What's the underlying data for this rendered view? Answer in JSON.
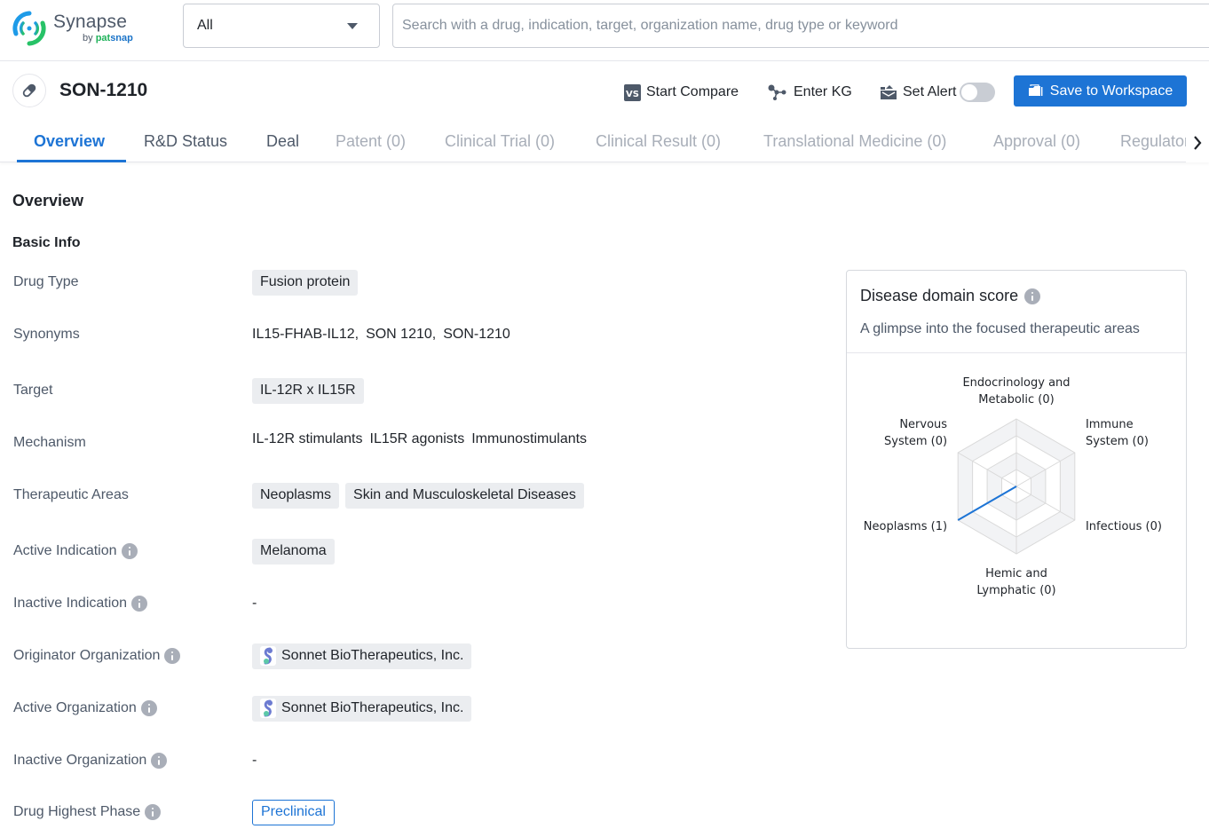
{
  "brand": {
    "name": "Synapse",
    "by": "by",
    "by_brand_1": "pat",
    "by_brand_2": "snap"
  },
  "search": {
    "scope_selected": "All",
    "placeholder": "Search with a drug, indication, target, organization name, drug type or keyword",
    "value": ""
  },
  "drug": {
    "name": "SON-1210",
    "icon": "pill-icon"
  },
  "actions": {
    "compare": "Start Compare",
    "kg": "Enter KG",
    "alert": "Set Alert",
    "alert_on": false,
    "save": "Save to Workspace"
  },
  "tabs": [
    {
      "label": "Overview",
      "state": "active"
    },
    {
      "label": "R&D Status",
      "state": "enabled"
    },
    {
      "label": "Deal",
      "state": "enabled"
    },
    {
      "label": "Patent (0)",
      "state": "disabled"
    },
    {
      "label": "Clinical Trial (0)",
      "state": "disabled"
    },
    {
      "label": "Clinical Result (0)",
      "state": "disabled"
    },
    {
      "label": "Translational Medicine (0)",
      "state": "disabled"
    },
    {
      "label": "Approval (0)",
      "state": "disabled"
    },
    {
      "label": "Regulatory",
      "state": "disabled"
    }
  ],
  "overview": {
    "title": "Overview",
    "basic_info_title": "Basic Info",
    "fields": {
      "drug_type": {
        "label": "Drug Type",
        "tags": [
          "Fusion protein"
        ]
      },
      "synonyms": {
        "label": "Synonyms",
        "values": [
          "IL15-FHAB-IL12,",
          "SON 1210,",
          "SON-1210"
        ]
      },
      "target": {
        "label": "Target",
        "tags": [
          "IL-12R x IL15R"
        ]
      },
      "mechanism": {
        "label": "Mechanism",
        "values": [
          "IL-12R stimulants",
          "IL15R agonists",
          "Immunostimulants"
        ]
      },
      "therapeutic_areas": {
        "label": "Therapeutic Areas",
        "tags": [
          "Neoplasms",
          "Skin and Musculoskeletal Diseases"
        ]
      },
      "active_indication": {
        "label": "Active Indication",
        "tags": [
          "Melanoma"
        ]
      },
      "inactive_indication": {
        "label": "Inactive Indication",
        "value": "-"
      },
      "originator_org": {
        "label": "Originator Organization",
        "org": "Sonnet BioTherapeutics, Inc."
      },
      "active_org": {
        "label": "Active Organization",
        "org": "Sonnet BioTherapeutics, Inc."
      },
      "inactive_org": {
        "label": "Inactive Organization",
        "value": "-"
      },
      "highest_phase": {
        "label": "Drug Highest Phase",
        "phase": "Preclinical"
      }
    }
  },
  "disease_card": {
    "title": "Disease domain score",
    "subtitle": "A glimpse into the focused therapeutic areas"
  },
  "chart_data": {
    "type": "radar",
    "title": "Disease domain score",
    "axes": [
      {
        "label_lines": [
          "Endocrinology and",
          "Metabolic (0)"
        ],
        "name": "Endocrinology and Metabolic",
        "value": 0
      },
      {
        "label_lines": [
          "Immune",
          "System (0)"
        ],
        "name": "Immune System",
        "value": 0
      },
      {
        "label_lines": [
          "Infectious (0)"
        ],
        "name": "Infectious",
        "value": 0
      },
      {
        "label_lines": [
          "Hemic and",
          "Lymphatic (0)"
        ],
        "name": "Hemic and Lymphatic",
        "value": 0
      },
      {
        "label_lines": [
          "Neoplasms (1)"
        ],
        "name": "Neoplasms",
        "value": 1
      },
      {
        "label_lines": [
          "Nervous",
          "System (0)"
        ],
        "name": "Nervous System",
        "value": 0
      }
    ],
    "max": 1,
    "rings": 4,
    "series_color": "#1d74d5"
  },
  "colors": {
    "accent": "#1d74d5",
    "tag_bg": "#ebedf0",
    "muted_text": "#4e5969",
    "disabled_tab": "#a8aeb8"
  }
}
